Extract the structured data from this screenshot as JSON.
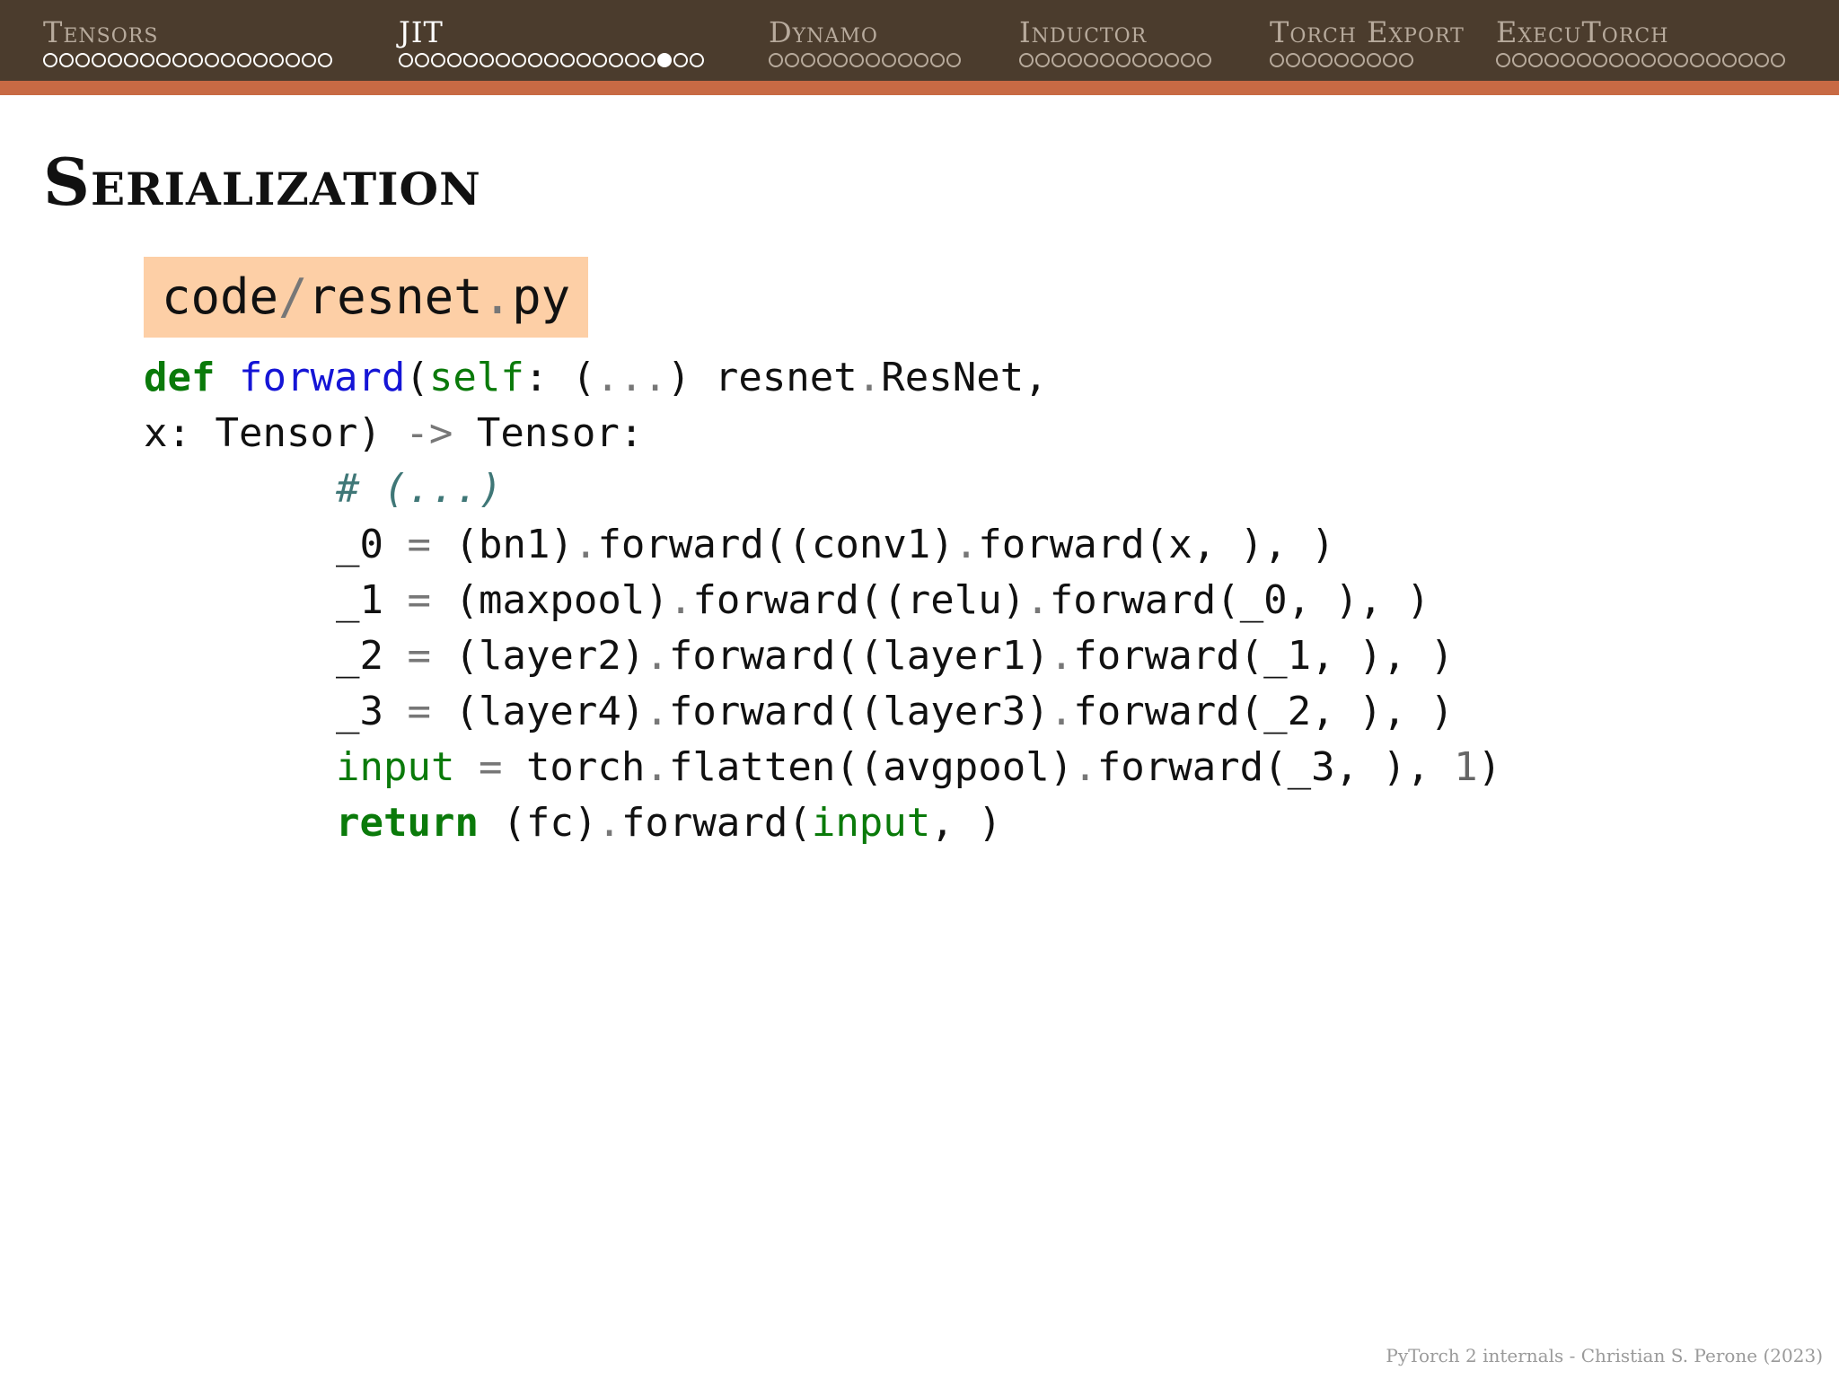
{
  "nav": {
    "sections": [
      {
        "title": "Tensors",
        "dots": 18,
        "seen": 18,
        "current": -1,
        "active": false
      },
      {
        "title": "JIT",
        "dots": 19,
        "seen": 16,
        "current": 16,
        "active": true
      },
      {
        "title": "Dynamo",
        "dots": 12,
        "seen": 0,
        "current": -1,
        "active": false
      },
      {
        "title": "Inductor",
        "dots": 12,
        "seen": 0,
        "current": -1,
        "active": false
      },
      {
        "title": "Torch Export",
        "dots": 9,
        "seen": 0,
        "current": -1,
        "active": false
      },
      {
        "title": "ExecuTorch",
        "dots": 18,
        "seen": 0,
        "current": -1,
        "active": false
      }
    ]
  },
  "slide": {
    "title": "Serialization",
    "file_label": {
      "dir": "code",
      "sep": "/",
      "name": "resnet",
      "dot": ".",
      "ext": "py"
    }
  },
  "code": {
    "line1": {
      "kw": "def",
      "fn": "forward",
      "open": "(",
      "self": "self",
      "rest1": ": (",
      "ell": "...",
      "rest2": ") resnet",
      "dot": ".",
      "rest3": "ResNet,"
    },
    "line2": {
      "a": "x: Tensor) ",
      "arrow": "->",
      "b": " Tensor:"
    },
    "line3": {
      "comment": "# (...)"
    },
    "line4": {
      "a": "_0 ",
      "eq": "=",
      "b": " (bn1)",
      "d1": ".",
      "c": "forward((conv1)",
      "d2": ".",
      "e": "forward(x, ), )"
    },
    "line5": {
      "a": "_1 ",
      "eq": "=",
      "b": " (maxpool)",
      "d1": ".",
      "c": "forward((relu)",
      "d2": ".",
      "e": "forward(_0, ), )"
    },
    "line6": {
      "a": "_2 ",
      "eq": "=",
      "b": " (layer2)",
      "d1": ".",
      "c": "forward((layer1)",
      "d2": ".",
      "e": "forward(_1, ), )"
    },
    "line7": {
      "a": "_3 ",
      "eq": "=",
      "b": " (layer4)",
      "d1": ".",
      "c": "forward((layer3)",
      "d2": ".",
      "e": "forward(_2, ), )"
    },
    "line8": {
      "input": "input",
      "eq": " = ",
      "b": "torch",
      "d1": ".",
      "c": "flatten((avgpool)",
      "d2": ".",
      "e": "forward(_3, ), ",
      "num": "1",
      "f": ")"
    },
    "line9": {
      "kw": "return",
      "b": " (fc)",
      "d1": ".",
      "c": "forward(",
      "input": "input",
      "e": ", )"
    }
  },
  "footer": {
    "text": "PyTorch 2 internals - Christian S. Perone (2023)"
  },
  "colors": {
    "topbar": "#4b3c2d",
    "stripe": "#c86a44",
    "file_label_bg": "#fdcfa6",
    "keyword": "#0a7a0a",
    "function": "#1515d6",
    "comment": "#3f7777"
  }
}
